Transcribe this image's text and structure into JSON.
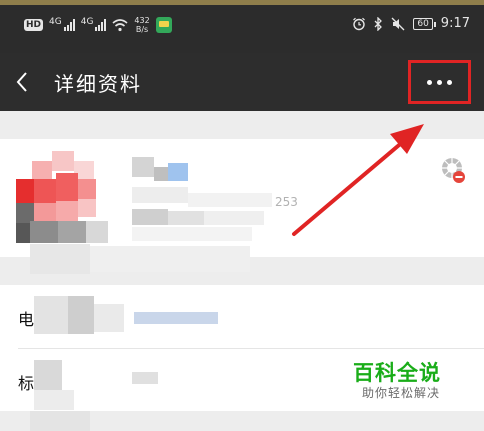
{
  "status_bar": {
    "hd_badge": "HD",
    "net1": "4G",
    "net2": "4G",
    "speed_value": "432",
    "speed_unit": "B/s",
    "battery": "60",
    "time": "9:17"
  },
  "navbar": {
    "title": "详细资料",
    "back_icon": "chevron-left-icon",
    "more_icon": "more-dots-icon"
  },
  "profile": {
    "id_suffix": "253",
    "badge_icon": "star-remove-icon"
  },
  "rows": [
    {
      "label_char": "电"
    },
    {
      "label_char": "标"
    }
  ],
  "watermark": {
    "title": "百科全说",
    "subtitle": "助你轻松解决"
  },
  "colors": {
    "header_bg": "#2d2d2d",
    "highlight_red": "#e02424",
    "watermark_green": "#1aad19"
  }
}
